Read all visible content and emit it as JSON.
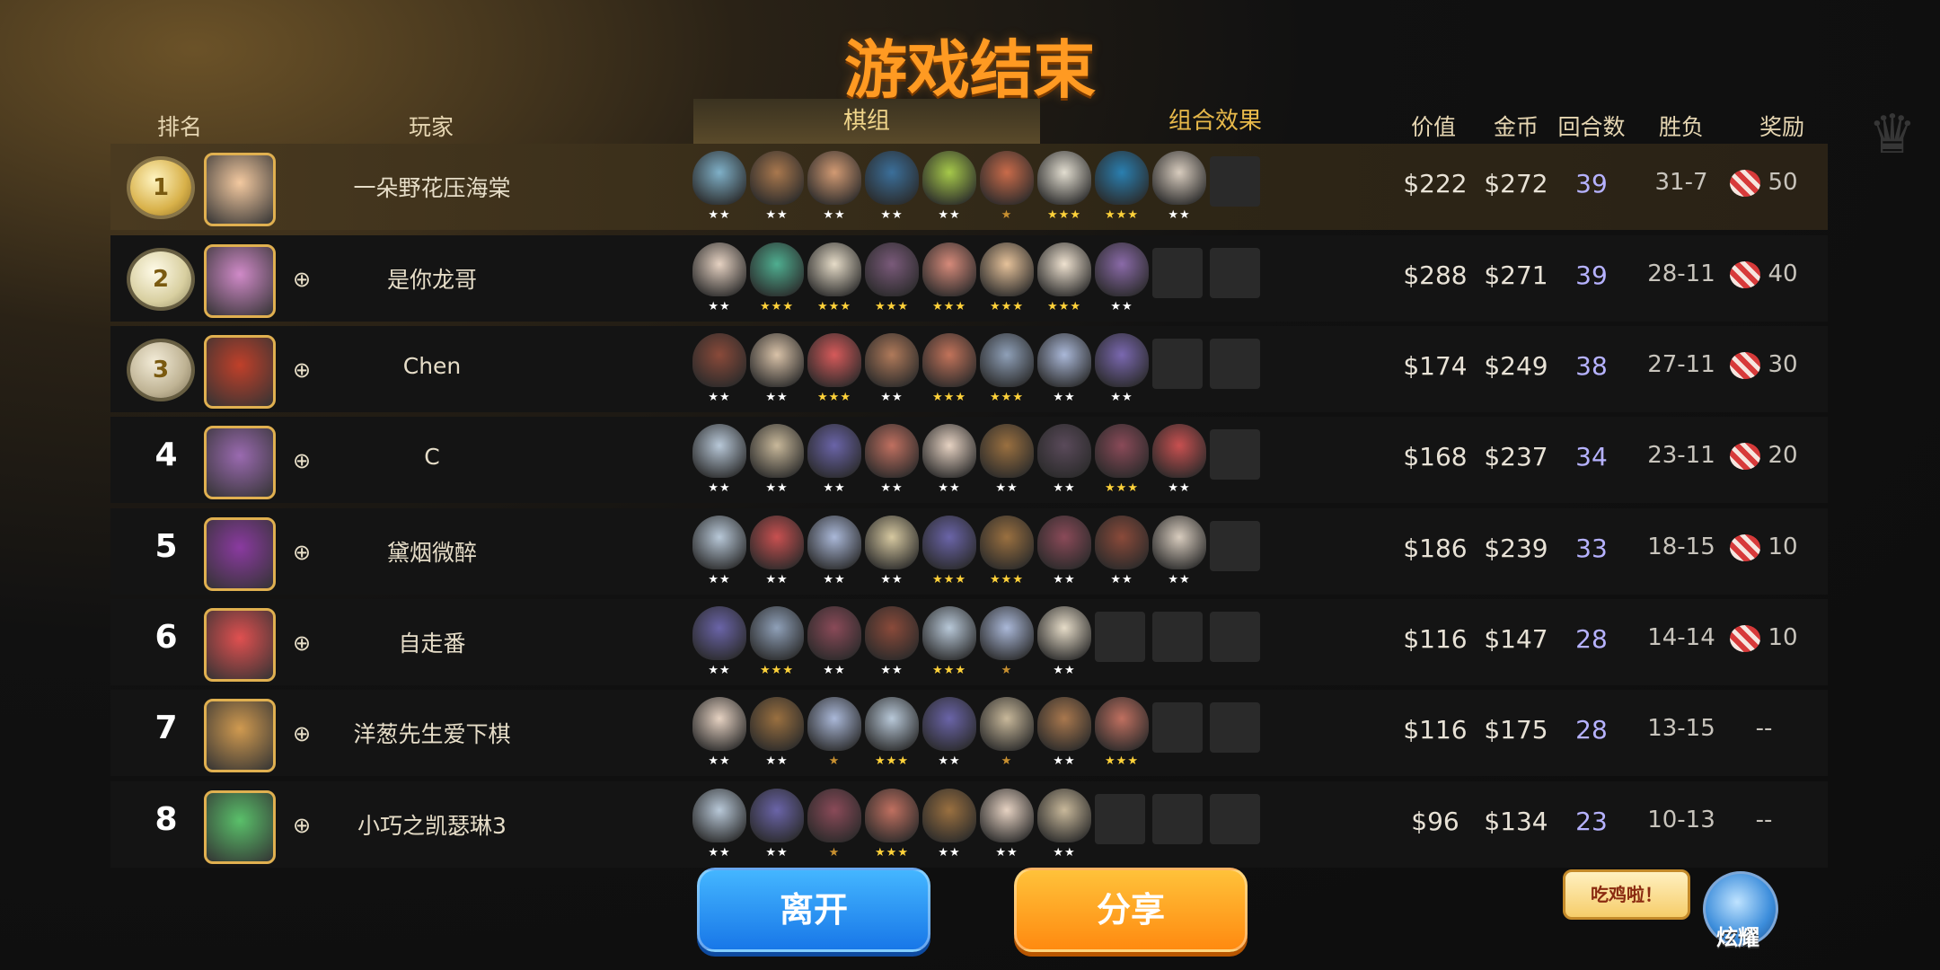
{
  "title": "游戏结束",
  "headers": {
    "rank": "排名",
    "player": "玩家",
    "lineup_tab": "棋组",
    "combo_tab": "组合效果",
    "value": "价值",
    "gold": "金币",
    "rounds": "回合数",
    "winloss": "胜负",
    "reward": "奖励"
  },
  "rows": [
    {
      "rank": "1",
      "name": "一朵野花压海棠",
      "value": "$222",
      "gold": "$272",
      "rounds": "39",
      "wl": "31-7",
      "reward": "50",
      "units": [
        {
          "c": "#7fb0c8",
          "s": 2
        },
        {
          "c": "#a9784e",
          "s": 2
        },
        {
          "c": "#d29a73",
          "s": 2
        },
        {
          "c": "#3b6f9a",
          "s": 2
        },
        {
          "c": "#a6c94a",
          "s": 2
        },
        {
          "c": "#c96b4a",
          "s": 1
        },
        {
          "c": "#e2ddd0",
          "s": 3
        },
        {
          "c": "#2a7fb0",
          "s": 3
        },
        {
          "c": "#d8ccbe",
          "s": 2
        }
      ],
      "empty": 1
    },
    {
      "rank": "2",
      "name": "是你龙哥",
      "value": "$288",
      "gold": "$271",
      "rounds": "39",
      "wl": "28-11",
      "reward": "40",
      "units": [
        {
          "c": "#e6d2c2",
          "s": 2
        },
        {
          "c": "#4fae90",
          "s": 3
        },
        {
          "c": "#e6dcc8",
          "s": 3
        },
        {
          "c": "#7a5a7a",
          "s": 3
        },
        {
          "c": "#d68a7a",
          "s": 3
        },
        {
          "c": "#e6c29a",
          "s": 3
        },
        {
          "c": "#efe2d0",
          "s": 3
        },
        {
          "c": "#8a6aa8",
          "s": 2
        }
      ],
      "empty": 2
    },
    {
      "rank": "3",
      "name": "Chen",
      "value": "$174",
      "gold": "$249",
      "rounds": "38",
      "wl": "27-11",
      "reward": "30",
      "units": [
        {
          "c": "#8a4a3a",
          "s": 2
        },
        {
          "c": "#d9c2a8",
          "s": 2
        },
        {
          "c": "#d65a5a",
          "s": 3
        },
        {
          "c": "#b07a5a",
          "s": 2
        },
        {
          "c": "#c2735a",
          "s": 3
        },
        {
          "c": "#8fa0b8",
          "s": 3
        },
        {
          "c": "#aab8d8",
          "s": 2
        },
        {
          "c": "#7a68b0",
          "s": 2
        }
      ],
      "empty": 2
    },
    {
      "rank": "4",
      "name": "C",
      "value": "$168",
      "gold": "$237",
      "rounds": "34",
      "wl": "23-11",
      "reward": "20",
      "units": [
        {
          "c": "#b8c8d8",
          "s": 2
        },
        {
          "c": "#c8b89a",
          "s": 2
        },
        {
          "c": "#6a64a8",
          "s": 2
        },
        {
          "c": "#c07060",
          "s": 2
        },
        {
          "c": "#e6d2c2",
          "s": 2
        },
        {
          "c": "#9a7040",
          "s": 2
        },
        {
          "c": "#5a4a5a",
          "s": 2
        },
        {
          "c": "#8a4a58",
          "s": 3
        },
        {
          "c": "#c85050",
          "s": 2
        }
      ],
      "empty": 1
    },
    {
      "rank": "5",
      "name": "黛烟微醉",
      "value": "$186",
      "gold": "$239",
      "rounds": "33",
      "wl": "18-15",
      "reward": "10",
      "units": [
        {
          "c": "#b8c8d8",
          "s": 2
        },
        {
          "c": "#c85050",
          "s": 2
        },
        {
          "c": "#aab8d8",
          "s": 2
        },
        {
          "c": "#d6c8a0",
          "s": 2
        },
        {
          "c": "#6a64a8",
          "s": 3
        },
        {
          "c": "#9a7040",
          "s": 3
        },
        {
          "c": "#8a4a58",
          "s": 2
        },
        {
          "c": "#8a4a3a",
          "s": 2
        },
        {
          "c": "#d8ccbe",
          "s": 2
        }
      ],
      "empty": 1
    },
    {
      "rank": "6",
      "name": "自走番",
      "value": "$116",
      "gold": "$147",
      "rounds": "28",
      "wl": "14-14",
      "reward": "10",
      "units": [
        {
          "c": "#6a64a8",
          "s": 2
        },
        {
          "c": "#8fa0b8",
          "s": 3
        },
        {
          "c": "#8a4a58",
          "s": 2
        },
        {
          "c": "#8a4a3a",
          "s": 2
        },
        {
          "c": "#b8c8d8",
          "s": 3
        },
        {
          "c": "#aab8d8",
          "s": 1
        },
        {
          "c": "#e6dcc8",
          "s": 2
        }
      ],
      "empty": 3
    },
    {
      "rank": "7",
      "name": "洋葱先生爱下棋",
      "value": "$116",
      "gold": "$175",
      "rounds": "28",
      "wl": "13-15",
      "reward": "--",
      "units": [
        {
          "c": "#e6d2c2",
          "s": 2
        },
        {
          "c": "#9a7040",
          "s": 2
        },
        {
          "c": "#aab8d8",
          "s": 1
        },
        {
          "c": "#b8c8d8",
          "s": 3
        },
        {
          "c": "#6a64a8",
          "s": 2
        },
        {
          "c": "#c8b89a",
          "s": 1
        },
        {
          "c": "#a9784e",
          "s": 2
        },
        {
          "c": "#c07060",
          "s": 3
        }
      ],
      "empty": 2
    },
    {
      "rank": "8",
      "name": "小巧之凯瑟琳3",
      "value": "$96",
      "gold": "$134",
      "rounds": "23",
      "wl": "10-13",
      "reward": "--",
      "units": [
        {
          "c": "#b8c8d8",
          "s": 2
        },
        {
          "c": "#6a64a8",
          "s": 2
        },
        {
          "c": "#8a4a58",
          "s": 1
        },
        {
          "c": "#c07060",
          "s": 3
        },
        {
          "c": "#9a7040",
          "s": 2
        },
        {
          "c": "#e6d2c2",
          "s": 2
        },
        {
          "c": "#c8b89a",
          "s": 2
        }
      ],
      "empty": 3
    }
  ],
  "avatars": [
    "#f3c9a0",
    "#d08ac8",
    "#c0402a",
    "#9a6ab0",
    "#8a3aa0",
    "#e05050",
    "#d09a50",
    "#5ac06a"
  ],
  "buttons": {
    "leave": "离开",
    "share": "分享"
  },
  "bubble": "吃鸡啦！",
  "mascot_label": "炫耀",
  "star_char": "★",
  "friend_icon_char": "⊕"
}
